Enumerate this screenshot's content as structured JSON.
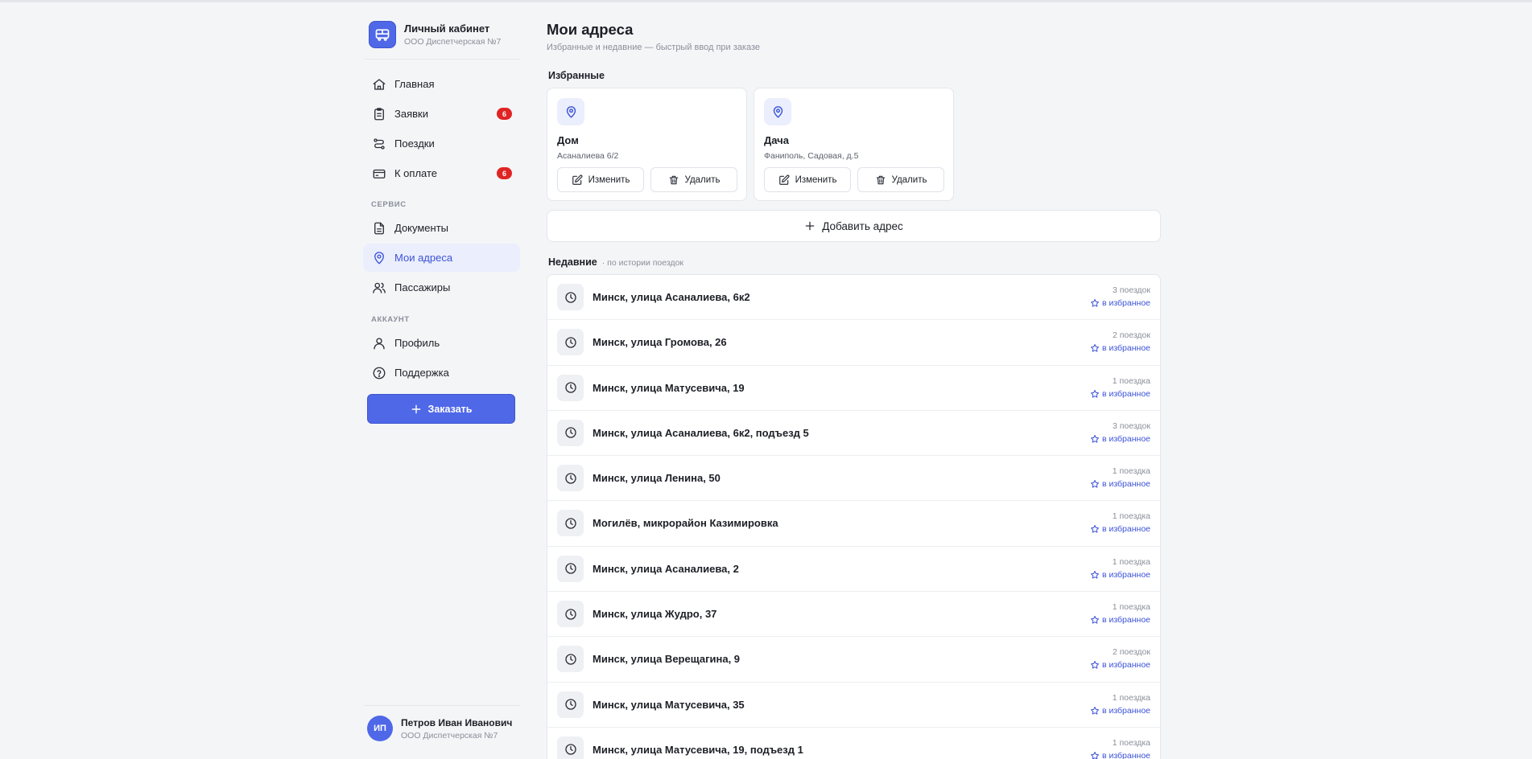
{
  "brand": {
    "title": "Личный кабинет",
    "subtitle": "ООО Диспетчерская №7"
  },
  "nav": {
    "items": [
      {
        "label": "Главная",
        "icon": "home-icon",
        "badge": null
      },
      {
        "label": "Заявки",
        "icon": "clipboard-icon",
        "badge": "6"
      },
      {
        "label": "Поездки",
        "icon": "route-icon",
        "badge": null
      },
      {
        "label": "К оплате",
        "icon": "card-icon",
        "badge": "6"
      }
    ],
    "service_title": "СЕРВИС",
    "service_items": [
      {
        "label": "Документы",
        "icon": "document-icon"
      },
      {
        "label": "Мои адреса",
        "icon": "map-pin-icon",
        "active": true
      },
      {
        "label": "Пассажиры",
        "icon": "users-icon"
      }
    ],
    "account_title": "АККАУНТ",
    "account_items": [
      {
        "label": "Профиль",
        "icon": "user-icon"
      },
      {
        "label": "Поддержка",
        "icon": "help-icon"
      }
    ],
    "order_label": "Заказать"
  },
  "user": {
    "initials": "ИП",
    "name": "Петров Иван Иванович",
    "company": "ООО Диспетчерская №7"
  },
  "page": {
    "title": "Мои адреса",
    "subtitle": "Избранные и недавние — быстрый ввод при заказе"
  },
  "favorites": {
    "title": "Избранные",
    "edit_label": "Изменить",
    "delete_label": "Удалить",
    "items": [
      {
        "name": "Дом",
        "address": "Асаналиева 6/2"
      },
      {
        "name": "Дача",
        "address": "Фаниполь, Садовая, д.5"
      }
    ],
    "add_label": "Добавить адрес"
  },
  "recent": {
    "title": "Недавние",
    "hint": "· по истории поездок",
    "fav_label": "в избранное",
    "items": [
      {
        "address": "Минск, улица Асаналиева, 6к2",
        "count": "3 поездок"
      },
      {
        "address": "Минск, улица Громова, 26",
        "count": "2 поездок"
      },
      {
        "address": "Минск, улица Матусевича, 19",
        "count": "1 поездка"
      },
      {
        "address": "Минск, улица Асаналиева, 6к2, подъезд 5",
        "count": "3 поездок"
      },
      {
        "address": "Минск, улица Ленина, 50",
        "count": "1 поездка"
      },
      {
        "address": "Могилёв, микрорайон Казимировка",
        "count": "1 поездка"
      },
      {
        "address": "Минск, улица Асаналиева, 2",
        "count": "1 поездка"
      },
      {
        "address": "Минск, улица Жудро, 37",
        "count": "1 поездка"
      },
      {
        "address": "Минск, улица Верещагина, 9",
        "count": "2 поездок"
      },
      {
        "address": "Минск, улица Матусевича, 35",
        "count": "1 поездка"
      },
      {
        "address": "Минск, улица Матусевича, 19, подъезд 1",
        "count": "1 поездка"
      }
    ]
  },
  "colors": {
    "accent": "#4f68e8",
    "active_text": "#3b53d8",
    "badge": "#e02424"
  }
}
